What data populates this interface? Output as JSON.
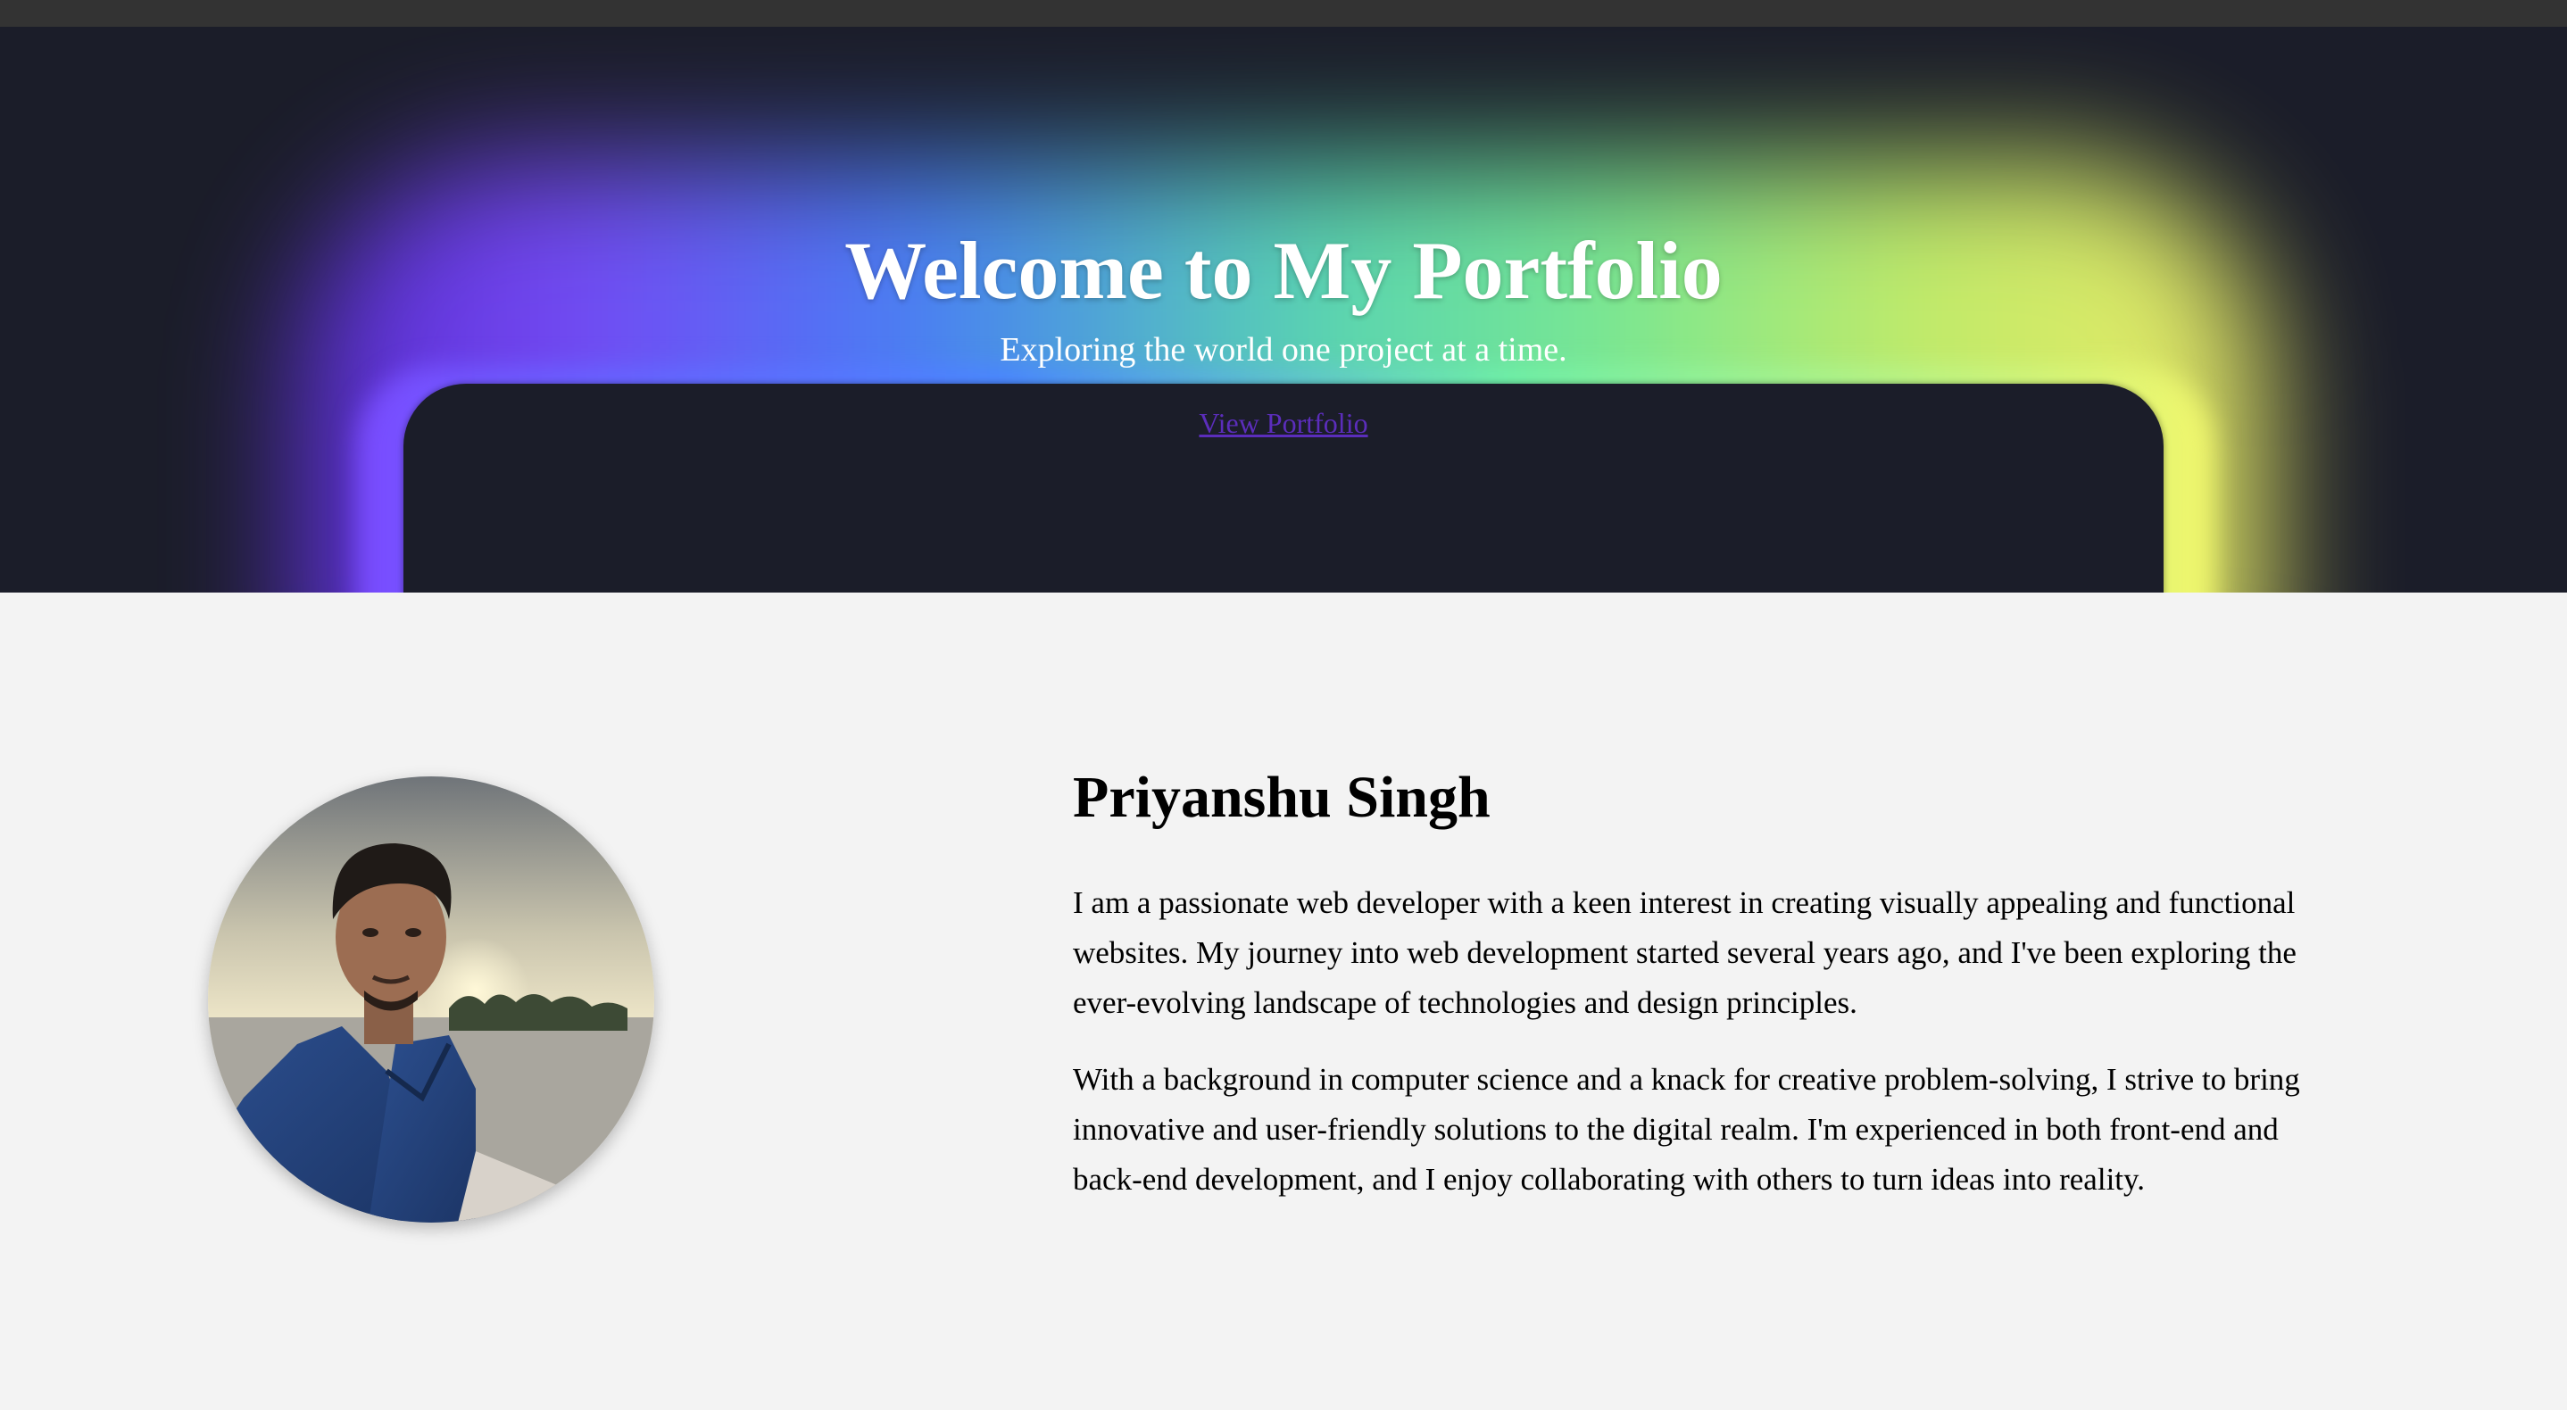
{
  "hero": {
    "title": "Welcome to My Portfolio",
    "subtitle": "Exploring the world one project at a time.",
    "cta_label": "View Portfolio"
  },
  "about": {
    "name": "Priyanshu Singh",
    "paragraphs": [
      "I am a passionate web developer with a keen interest in creating visually appealing and functional websites. My journey into web development started several years ago, and I've been exploring the ever-evolving landscape of technologies and design principles.",
      "With a background in computer science and a knack for creative problem-solving, I strive to bring innovative and user-friendly solutions to the digital realm. I'm experienced in both front-end and back-end development, and I enjoy collaborating with others to turn ideas into reality."
    ]
  },
  "colors": {
    "topbar": "#333333",
    "hero_background": "#1b1d29",
    "link": "#5b2dbb",
    "page_background": "#f3f3f3"
  }
}
